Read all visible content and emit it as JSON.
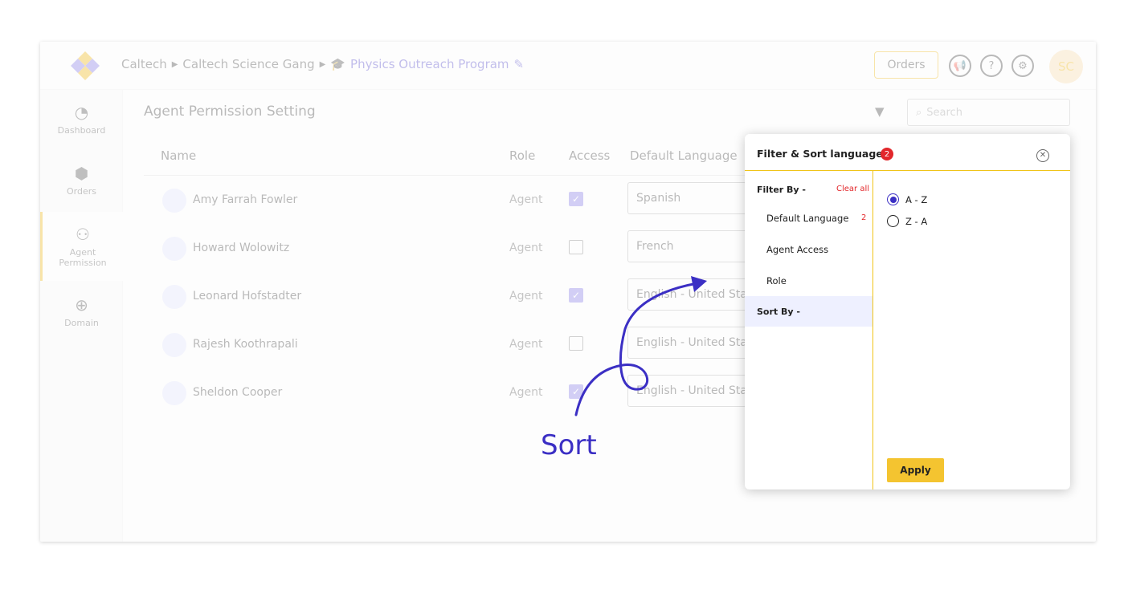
{
  "header": {
    "breadcrumb": [
      "Caltech",
      "Caltech Science Gang",
      "Physics Outreach Program"
    ],
    "orders_label": "Orders",
    "avatar_initials": "SC"
  },
  "sidebar": {
    "items": [
      {
        "label": "Dashboard",
        "icon": "pie-chart-icon"
      },
      {
        "label": "Orders",
        "icon": "box-icon"
      },
      {
        "label": "Agent Permission",
        "icon": "agent-settings-icon"
      },
      {
        "label": "Domain",
        "icon": "globe-icon"
      }
    ]
  },
  "main": {
    "title": "Agent Permission Setting",
    "search_placeholder": "Search",
    "columns": [
      "Name",
      "Role",
      "Access",
      "Default Language"
    ],
    "rows": [
      {
        "name": "Amy Farrah Fowler",
        "role": "Agent",
        "access": true,
        "language": "Spanish"
      },
      {
        "name": "Howard Wolowitz",
        "role": "Agent",
        "access": false,
        "language": "French"
      },
      {
        "name": "Leonard Hofstadter",
        "role": "Agent",
        "access": true,
        "language": "English - United States"
      },
      {
        "name": "Rajesh Koothrapali",
        "role": "Agent",
        "access": false,
        "language": "English - United States"
      },
      {
        "name": "Sheldon Cooper",
        "role": "Agent",
        "access": true,
        "language": "English - United States"
      }
    ]
  },
  "panel": {
    "title": "Filter & Sort languages",
    "badge": "2",
    "filter_by": "Filter By -",
    "clear_all": "Clear all",
    "options": [
      "Default Language",
      "Agent Access",
      "Role"
    ],
    "default_language_count": "2",
    "sort_by": "Sort By -",
    "sort_options": [
      "A - Z",
      "Z - A"
    ],
    "selected_sort": "A - Z",
    "apply": "Apply"
  },
  "annotation": {
    "label": "Sort",
    "color": "#3b2fc4"
  },
  "colors": {
    "accent_yellow": "#f0b400",
    "accent_purple": "#4a3fc7",
    "badge_red": "#e2272b"
  }
}
